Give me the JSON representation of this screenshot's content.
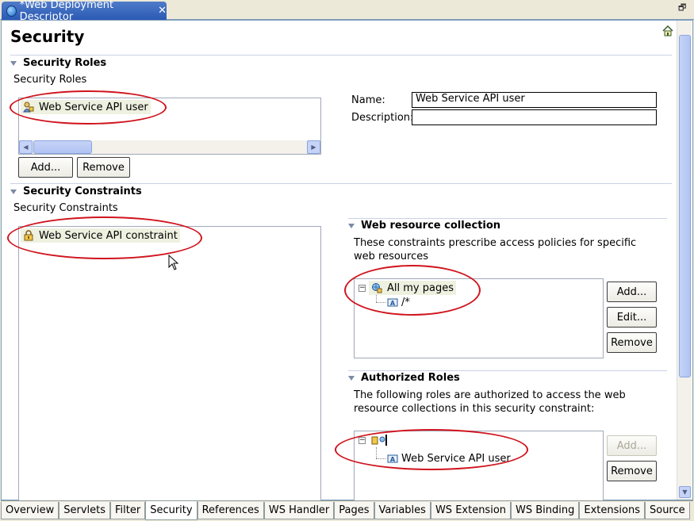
{
  "editor_tab": {
    "title": "*Web Deployment Descriptor"
  },
  "page": {
    "title": "Security"
  },
  "roles_section": {
    "header": "Security Roles",
    "sublabel": "Security Roles",
    "items": [
      {
        "label": "Web Service API user"
      }
    ],
    "add_label": "Add...",
    "remove_label": "Remove",
    "name_label": "Name:",
    "name_value": "Web Service API user",
    "description_label": "Description:",
    "description_value": ""
  },
  "constraints_section": {
    "header": "Security Constraints",
    "sublabel": "Security Constraints",
    "items": [
      {
        "label": "Web Service API constraint"
      }
    ]
  },
  "web_resource": {
    "header": "Web resource collection",
    "description": "These constraints prescribe access policies for specific web resources",
    "tree_root": "All my pages",
    "tree_child": "/*",
    "add_label": "Add...",
    "edit_label": "Edit...",
    "remove_label": "Remove"
  },
  "authorized_roles": {
    "header": "Authorized Roles",
    "description": "The following roles are authorized to access the web resource collections in this security constraint:",
    "tree_child": "Web Service API user",
    "add_label": "Add...",
    "remove_label": "Remove"
  },
  "bottom_tabs": [
    {
      "label": "Overview"
    },
    {
      "label": "Servlets"
    },
    {
      "label": "Filter"
    },
    {
      "label": "Security"
    },
    {
      "label": "References"
    },
    {
      "label": "WS Handler"
    },
    {
      "label": "Pages"
    },
    {
      "label": "Variables"
    },
    {
      "label": "WS Extension"
    },
    {
      "label": "WS Binding"
    },
    {
      "label": "Extensions"
    },
    {
      "label": "Source"
    }
  ],
  "active_tab": "Security",
  "colors": {
    "annotation": "#d0141e",
    "tab_active": "#2b5ab5"
  },
  "icons": {
    "editor_tab": "globe-icon",
    "home": "home-icon",
    "role": "security-role-icon",
    "constraint": "lock-icon",
    "collection": "web-collection-icon",
    "url_pattern": "url-pattern-icon",
    "authorized": "auth-constraint-icon"
  }
}
